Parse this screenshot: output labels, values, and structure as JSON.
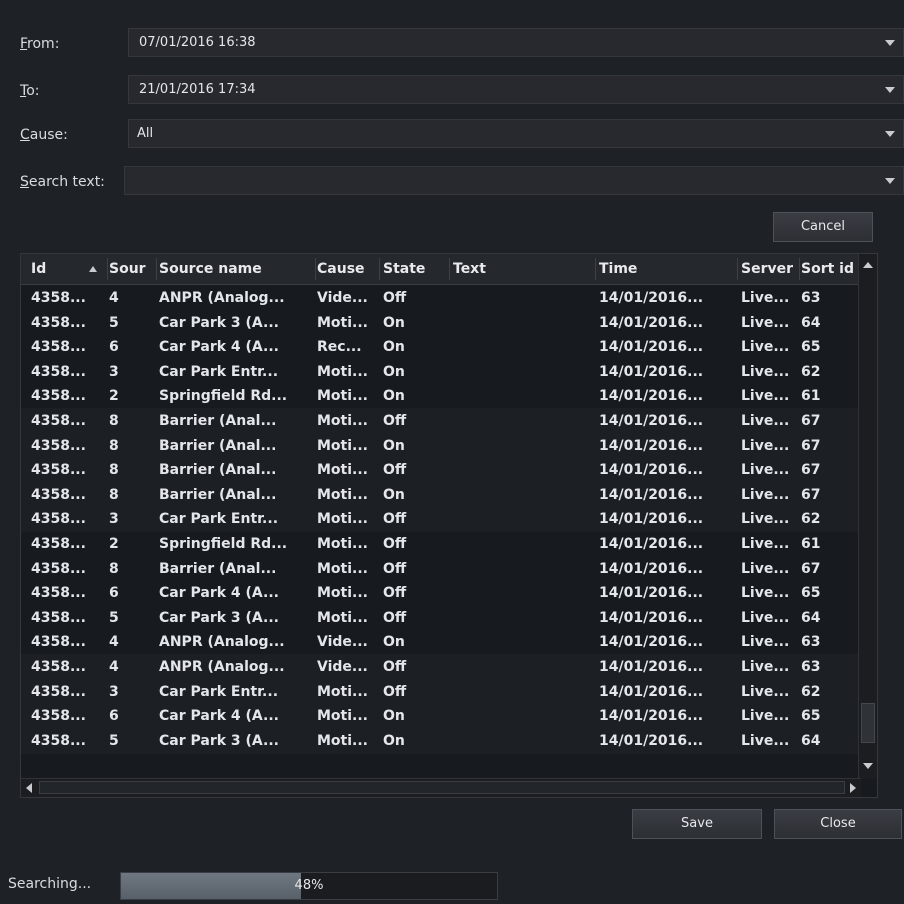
{
  "form": {
    "from_label_u": "F",
    "from_label_rest": "rom:",
    "from_value": "07/01/2016 16:38",
    "to_label_u": "T",
    "to_label_rest": "o:",
    "to_value": "21/01/2016 17:34",
    "cause_label_u": "C",
    "cause_label_rest": "ause:",
    "cause_value": "All",
    "search_label_u": "S",
    "search_label_rest": "earch text:",
    "search_value": ""
  },
  "buttons": {
    "cancel": "Cancel",
    "save": "Save",
    "close": "Close"
  },
  "table": {
    "columns": [
      {
        "key": "id",
        "label": "Id"
      },
      {
        "key": "source",
        "label": "Sour"
      },
      {
        "key": "source_name",
        "label": "Source name"
      },
      {
        "key": "cause",
        "label": "Cause"
      },
      {
        "key": "state",
        "label": "State"
      },
      {
        "key": "text",
        "label": "Text"
      },
      {
        "key": "time",
        "label": "Time"
      },
      {
        "key": "server",
        "label": "Server"
      },
      {
        "key": "sort_id",
        "label": "Sort id"
      }
    ],
    "sort_column": "id",
    "sort_direction": "ascending",
    "rows": [
      [
        "4358...",
        "4",
        "ANPR (Analog...",
        "Vide...",
        "Off",
        "",
        "14/01/2016...",
        "Live...",
        "63"
      ],
      [
        "4358...",
        "5",
        "Car Park 3 (A...",
        "Moti...",
        "On",
        "",
        "14/01/2016...",
        "Live...",
        "64"
      ],
      [
        "4358...",
        "6",
        "Car Park 4 (A...",
        "Rec...",
        "On",
        "",
        "14/01/2016...",
        "Live...",
        "65"
      ],
      [
        "4358...",
        "3",
        "Car Park Entr...",
        "Moti...",
        "On",
        "",
        "14/01/2016...",
        "Live...",
        "62"
      ],
      [
        "4358...",
        "2",
        "Springfield Rd...",
        "Moti...",
        "On",
        "",
        "14/01/2016...",
        "Live...",
        "61"
      ],
      [
        "4358...",
        "8",
        "Barrier (Anal...",
        "Moti...",
        "Off",
        "",
        "14/01/2016...",
        "Live...",
        "67"
      ],
      [
        "4358...",
        "8",
        "Barrier (Anal...",
        "Moti...",
        "On",
        "",
        "14/01/2016...",
        "Live...",
        "67"
      ],
      [
        "4358...",
        "8",
        "Barrier (Anal...",
        "Moti...",
        "Off",
        "",
        "14/01/2016...",
        "Live...",
        "67"
      ],
      [
        "4358...",
        "8",
        "Barrier (Anal...",
        "Moti...",
        "On",
        "",
        "14/01/2016...",
        "Live...",
        "67"
      ],
      [
        "4358...",
        "3",
        "Car Park Entr...",
        "Moti...",
        "Off",
        "",
        "14/01/2016...",
        "Live...",
        "62"
      ],
      [
        "4358...",
        "2",
        "Springfield Rd...",
        "Moti...",
        "Off",
        "",
        "14/01/2016...",
        "Live...",
        "61"
      ],
      [
        "4358...",
        "8",
        "Barrier (Anal...",
        "Moti...",
        "Off",
        "",
        "14/01/2016...",
        "Live...",
        "67"
      ],
      [
        "4358...",
        "6",
        "Car Park 4 (A...",
        "Moti...",
        "Off",
        "",
        "14/01/2016...",
        "Live...",
        "65"
      ],
      [
        "4358...",
        "5",
        "Car Park 3 (A...",
        "Moti...",
        "Off",
        "",
        "14/01/2016...",
        "Live...",
        "64"
      ],
      [
        "4358...",
        "4",
        "ANPR (Analog...",
        "Vide...",
        "On",
        "",
        "14/01/2016...",
        "Live...",
        "63"
      ],
      [
        "4358...",
        "4",
        "ANPR (Analog...",
        "Vide...",
        "Off",
        "",
        "14/01/2016...",
        "Live...",
        "63"
      ],
      [
        "4358...",
        "3",
        "Car Park Entr...",
        "Moti...",
        "Off",
        "",
        "14/01/2016...",
        "Live...",
        "62"
      ],
      [
        "4358...",
        "6",
        "Car Park 4 (A...",
        "Moti...",
        "On",
        "",
        "14/01/2016...",
        "Live...",
        "65"
      ],
      [
        "4358...",
        "5",
        "Car Park 3 (A...",
        "Moti...",
        "On",
        "",
        "14/01/2016...",
        "Live...",
        "64"
      ]
    ]
  },
  "status": {
    "label": "Searching...",
    "progress_percent": 48,
    "progress_text": "48%"
  },
  "icons": {
    "combo_arrow": "chevron-down-icon",
    "sort": "sort-ascending-icon",
    "scroll_up": "scroll-up-icon",
    "scroll_down": "scroll-down-icon",
    "scroll_left": "scroll-left-icon",
    "scroll_right": "scroll-right-icon"
  },
  "colors": {
    "background": "#1e2126",
    "grid_background": "#171a1e",
    "progress_fill": "#6f7781"
  }
}
